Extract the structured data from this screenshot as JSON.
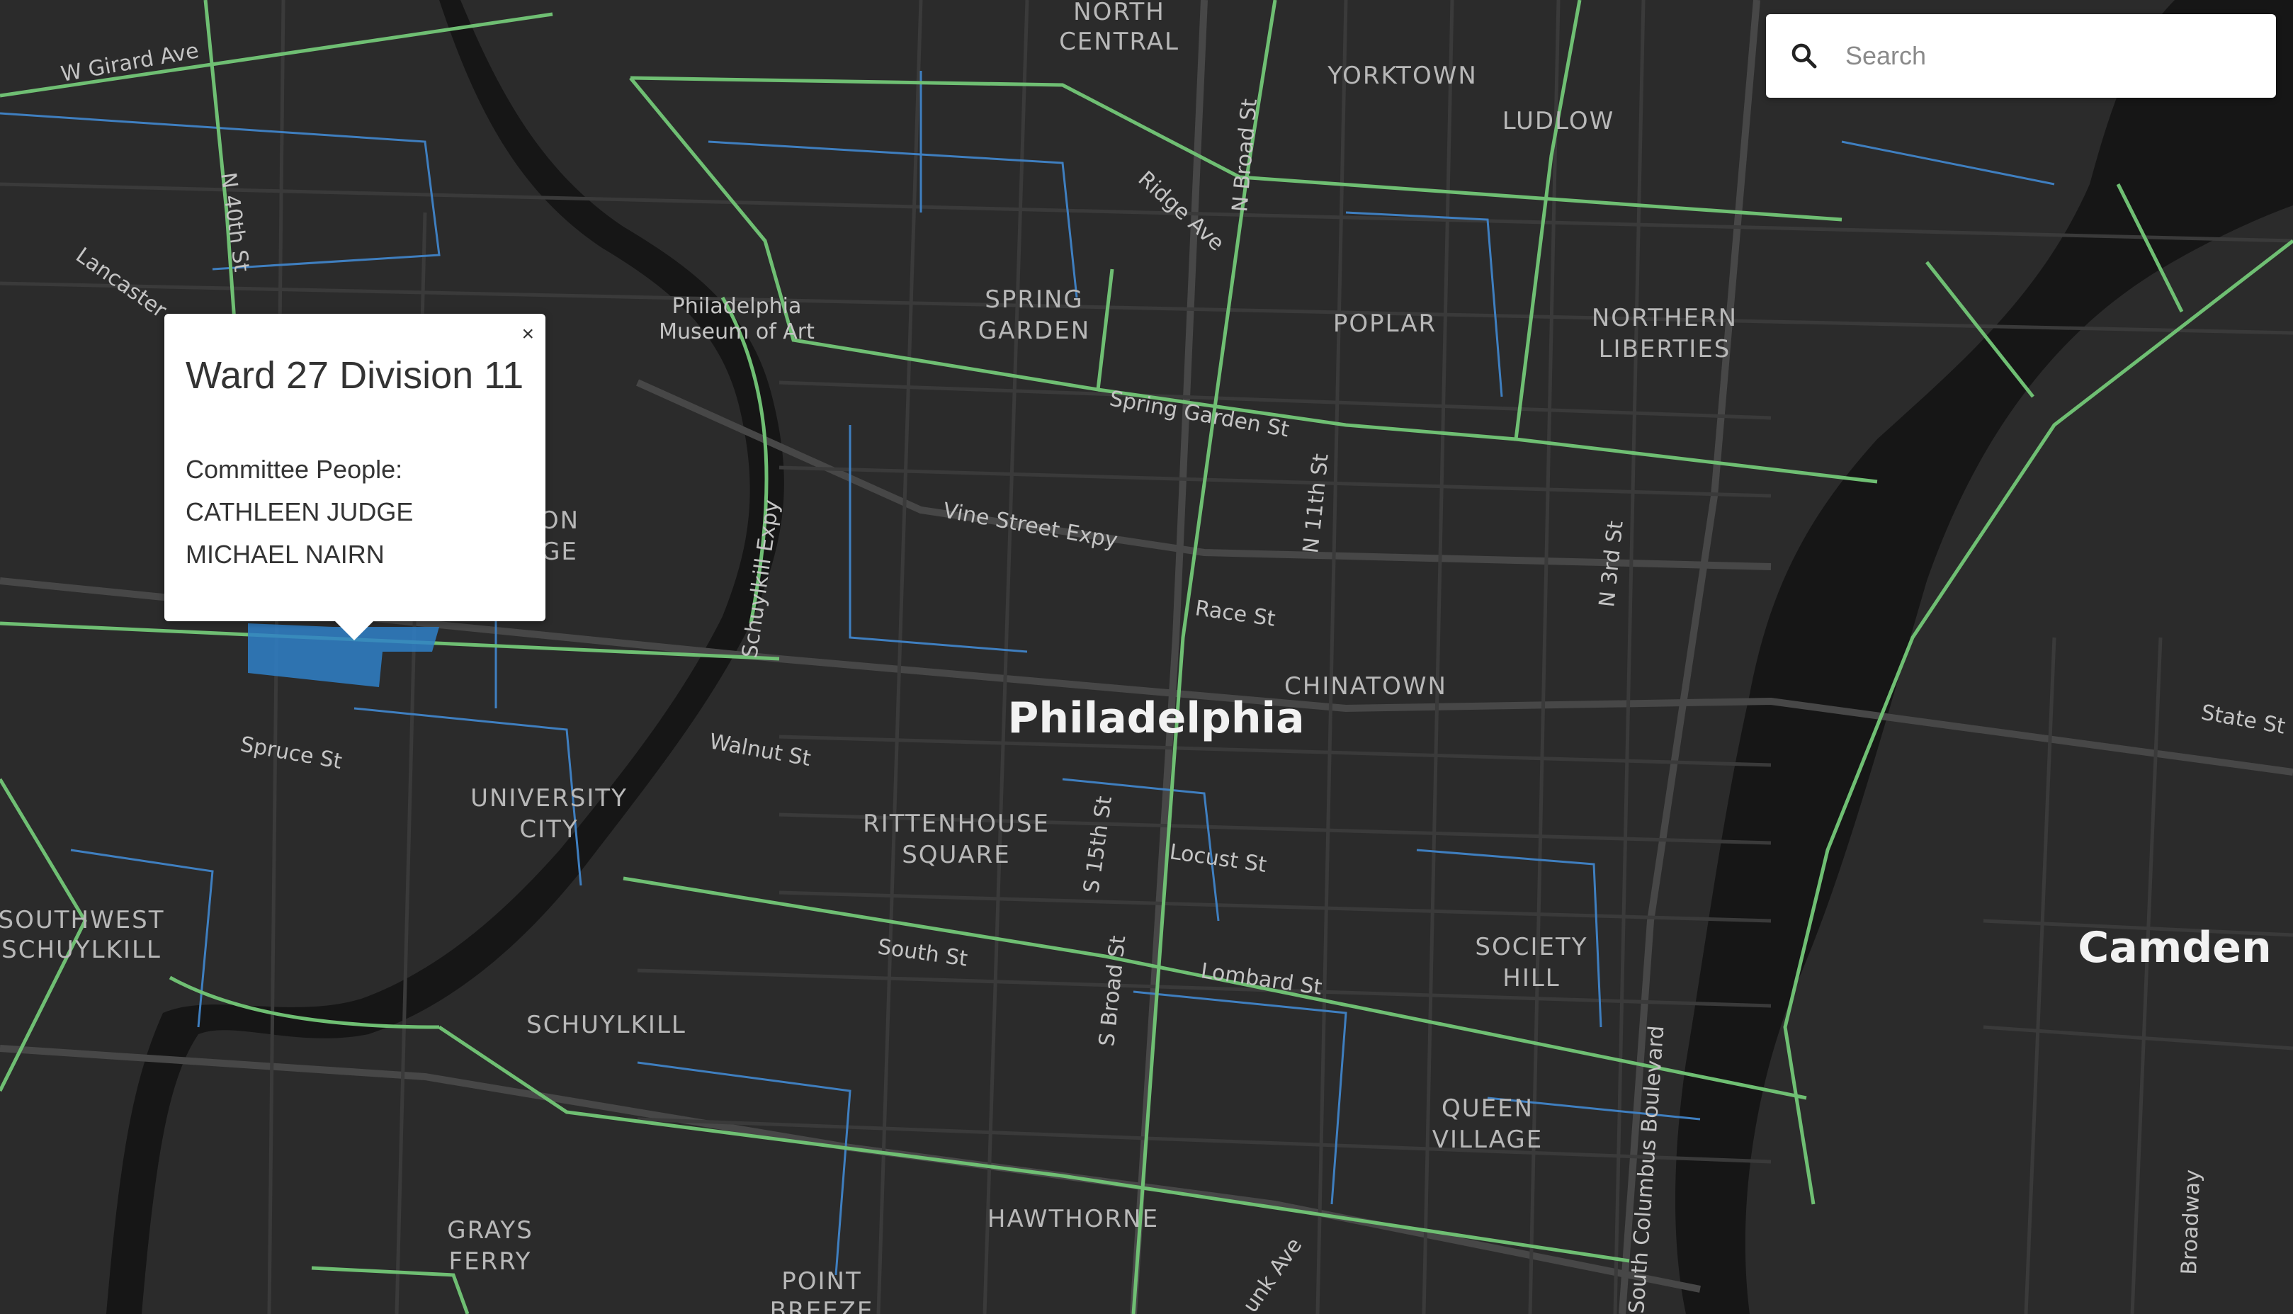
{
  "search": {
    "placeholder": "Search",
    "icon": "search-icon"
  },
  "popup": {
    "title": "Ward 27 Division 11",
    "close_label": "×",
    "committee_label": "Committee People:",
    "people": [
      "CATHLEEN JUDGE",
      "MICHAEL NAIRN"
    ]
  },
  "map": {
    "city_labels": {
      "philadelphia": "Philadelphia",
      "camden": "Camden"
    },
    "neighborhoods": {
      "north_central": [
        "NORTH",
        "CENTRAL"
      ],
      "yorktown": "YORKTOWN",
      "ludlow": "LUDLOW",
      "spring_garden": [
        "SPRING",
        "GARDEN"
      ],
      "poplar": "POPLAR",
      "northern_liberties": [
        "NORTHERN",
        "LIBERTIES"
      ],
      "philadelphia_museum": [
        "Philadelphia",
        "Museum of Art"
      ],
      "powelton_partial": [
        "ON",
        "GE"
      ],
      "chinatown": "CHINATOWN",
      "university_city": [
        "UNIVERSITY",
        "CITY"
      ],
      "rittenhouse_square": [
        "RITTENHOUSE",
        "SQUARE"
      ],
      "southwest_schuylkill": [
        "SOUTHWEST",
        "SCHUYLKILL"
      ],
      "society_hill": [
        "SOCIETY",
        "HILL"
      ],
      "schuylkill": "SCHUYLKILL",
      "queen_village": [
        "QUEEN",
        "VILLAGE"
      ],
      "grays_ferry": [
        "GRAYS",
        "FERRY"
      ],
      "hawthorne": "HAWTHORNE",
      "point_breeze": [
        "POINT",
        "BREEZE"
      ]
    },
    "streets": {
      "w_girard": "W Girard Ave",
      "n_40th": "N 40th St",
      "lancaster": "Lancaster",
      "n_broad": "N Broad St",
      "ridge_ave": "Ridge Ave",
      "spring_garden_st": "Spring Garden St",
      "vine_street_expy": "Vine Street Expy",
      "schuylkill_expy": "Schuylkill Expy",
      "n_11th": "N 11th St",
      "n_3rd": "N 3rd St",
      "race_st": "Race St",
      "state_st": "State St",
      "spruce_st": "Spruce St",
      "walnut_st": "Walnut St",
      "s_15th": "S 15th St",
      "locust_st": "Locust St",
      "south_st": "South St",
      "lombard_st": "Lombard St",
      "s_broad": "S Broad St",
      "columbus_blvd": "South Columbus Boulevard",
      "broadway": "Broadway",
      "sunk_ave": "unk Ave"
    },
    "colors": {
      "background": "#2b2b2b",
      "river": "#161616",
      "ward_boundary": "#6fbf73",
      "division_boundary": "#3f7fc0",
      "highlight": "#2f80c8",
      "roads": "#4a4a4a"
    }
  }
}
